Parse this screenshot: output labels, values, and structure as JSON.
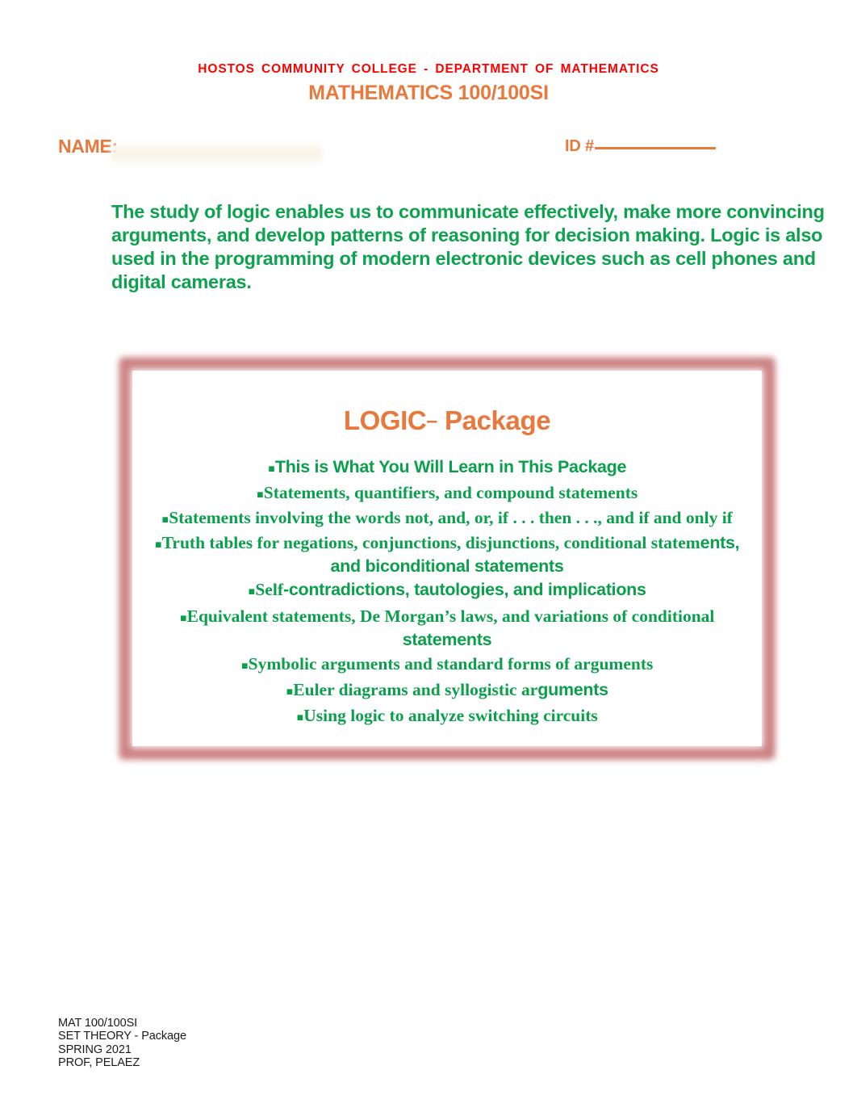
{
  "header": {
    "line1": "HOSTOS COMMUNITY COLLEGE - DEPARTMENT OF MATHEMATICS",
    "line2": "MATHEMATICS 100/100SI",
    "line1_color": "#ff0000",
    "line2_color": "#e8783c"
  },
  "form": {
    "name_label": "NAME:",
    "name_value": "",
    "id_label": "ID #",
    "id_value": "",
    "label_color": "#e8783c"
  },
  "intro": {
    "text": "The study of logic enables us to communicate effectively, make more convincing arguments, and develop patterns of reasoning for decision making. Logic is also used in the programming of modern electronic devices such as cell phones and digital cameras.",
    "color": "#0da24e"
  },
  "logic_box": {
    "title_main": "LOGIC",
    "title_dash": "–",
    "title_rest": "Package",
    "title_color": "#e8783c",
    "border_color": "#c87a7c",
    "bullet_glyph": "▪",
    "bullet_color": "#0a9f4a",
    "bullets": [
      {
        "text": "This is What You Will Learn in This Package",
        "parts": [
          {
            "text": "This is What You Will Learn in This Package",
            "style": "sans"
          }
        ]
      },
      {
        "text": "Statements, quantifiers, and compound statements",
        "parts": [
          {
            "text": "Statements, quantifiers, and compound statements",
            "style": "serif"
          }
        ]
      },
      {
        "text": "Statements involving the words not, and, or, if . . . then . . ., and if and only if",
        "parts": [
          {
            "text": "Statements involving the words not, and, or, if . . . then . . ., and if and only if",
            "style": "serif"
          }
        ]
      },
      {
        "text": "Truth tables for negations, conjunctions, disjunctions, conditional statements, and biconditional statements",
        "parts": [
          {
            "text": "Truth tables for negations, conjunctions, disjunctions, conditional statem",
            "style": "serif"
          },
          {
            "text": "ents,",
            "style": "sans"
          },
          {
            "text": "and biconditional statements",
            "style": "sans"
          }
        ]
      },
      {
        "text": "Self-contradictions, tautologies, and implications",
        "parts": [
          {
            "text": "Self",
            "style": "serif"
          },
          {
            "text": "-contradictions, tautologies, and implications",
            "style": "sans"
          }
        ]
      },
      {
        "text": "Equivalent statements, De Morgan’s laws, and variations of conditional statements",
        "parts": [
          {
            "text": "Equivalent statements, De Morgan’s laws, and variations of conditional",
            "style": "serif"
          },
          {
            "text": "statements",
            "style": "sans"
          }
        ]
      },
      {
        "text": "Symbolic arguments and standard forms of arguments",
        "parts": [
          {
            "text": "Symbolic arguments and standard forms of arguments",
            "style": "serif"
          }
        ]
      },
      {
        "text": "Euler diagrams and syllogistic arguments",
        "parts": [
          {
            "text": "Euler diagrams and syllogistic ar",
            "style": "serif"
          },
          {
            "text": "guments",
            "style": "sans"
          }
        ]
      },
      {
        "text": "Using logic to analyze switching circuits",
        "parts": [
          {
            "text": "Using logic to analyze switching circuits",
            "style": "serif"
          }
        ]
      }
    ]
  },
  "footer": {
    "line1": "MAT 100/100SI",
    "line2": "SET THEORY - Package",
    "line3": "SPRING 2021",
    "line4": "PROF, PELAEZ"
  }
}
